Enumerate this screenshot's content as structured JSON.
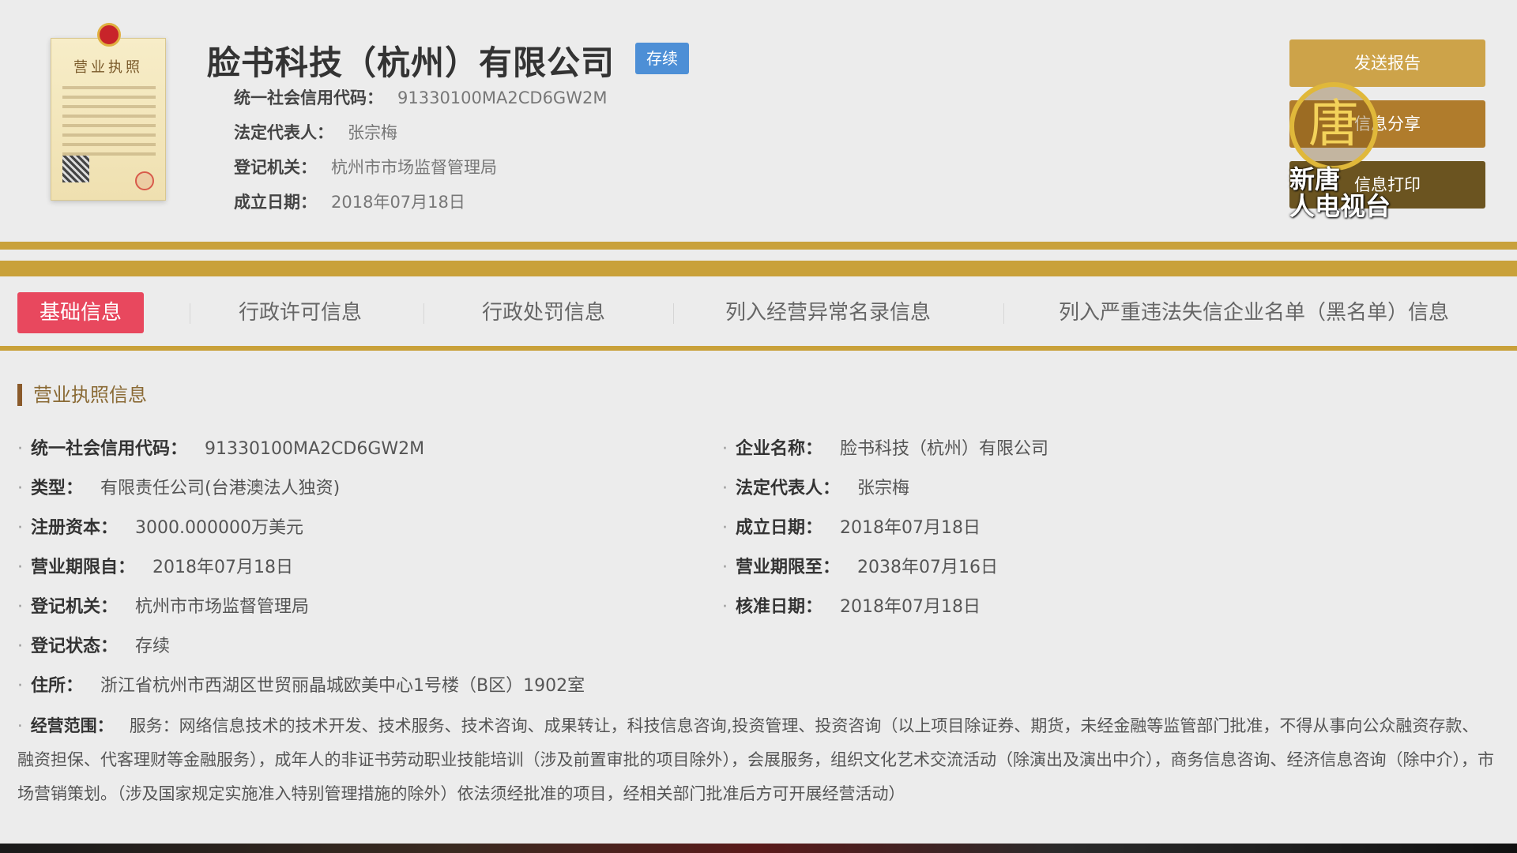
{
  "header": {
    "company_name": "脸书科技（杭州）有限公司",
    "status_badge": "存续",
    "meta": [
      {
        "label": "统一社会信用代码：",
        "value": "91330100MA2CD6GW2M"
      },
      {
        "label": "法定代表人：",
        "value": "张宗梅"
      },
      {
        "label": "登记机关：",
        "value": "杭州市市场监督管理局"
      },
      {
        "label": "成立日期：",
        "value": "2018年07月18日"
      }
    ],
    "license_thumb": {
      "title": "营业执照"
    },
    "actions": {
      "report": "发送报告",
      "share": "信息分享",
      "print": "信息打印"
    }
  },
  "watermark": {
    "emblem": "唐",
    "line1": "新唐",
    "line2": "人电视台"
  },
  "tabs": [
    {
      "label": "基础信息",
      "active": true
    },
    {
      "label": "行政许可信息",
      "active": false
    },
    {
      "label": "行政处罚信息",
      "active": false
    },
    {
      "label": "列入经营异常名录信息",
      "active": false
    },
    {
      "label": "列入严重违法失信企业名单（黑名单）信息",
      "active": false
    }
  ],
  "section": {
    "title": "营业执照信息",
    "left": [
      {
        "label": "统一社会信用代码：",
        "value": "91330100MA2CD6GW2M"
      },
      {
        "label": "类型：",
        "value": "有限责任公司(台港澳法人独资)"
      },
      {
        "label": "注册资本：",
        "value": "3000.000000万美元"
      },
      {
        "label": "营业期限自：",
        "value": "2018年07月18日"
      },
      {
        "label": "登记机关：",
        "value": "杭州市市场监督管理局"
      },
      {
        "label": "登记状态：",
        "value": "存续"
      },
      {
        "label": "住所：",
        "value": "浙江省杭州市西湖区世贸丽晶城欧美中心1号楼（B区）1902室"
      }
    ],
    "right": [
      {
        "label": "企业名称：",
        "value": "脸书科技（杭州）有限公司"
      },
      {
        "label": "法定代表人：",
        "value": "张宗梅"
      },
      {
        "label": "成立日期：",
        "value": "2018年07月18日"
      },
      {
        "label": "营业期限至：",
        "value": "2038年07月16日"
      },
      {
        "label": "核准日期：",
        "value": "2018年07月18日"
      }
    ],
    "scope": {
      "label": "经营范围：",
      "value": "服务：网络信息技术的技术开发、技术服务、技术咨询、成果转让，科技信息咨询,投资管理、投资咨询（以上项目除证券、期货，未经金融等监管部门批准，不得从事向公众融资存款、融资担保、代客理财等金融服务），成年人的非证书劳动职业技能培训（涉及前置审批的项目除外），会展服务，组织文化艺术交流活动（除演出及演出中介），商务信息咨询、经济信息咨询（除中介），市场营销策划。（涉及国家规定实施准入特别管理措施的除外）依法须经批准的项目，经相关部门批准后方可开展经营活动）"
    }
  }
}
